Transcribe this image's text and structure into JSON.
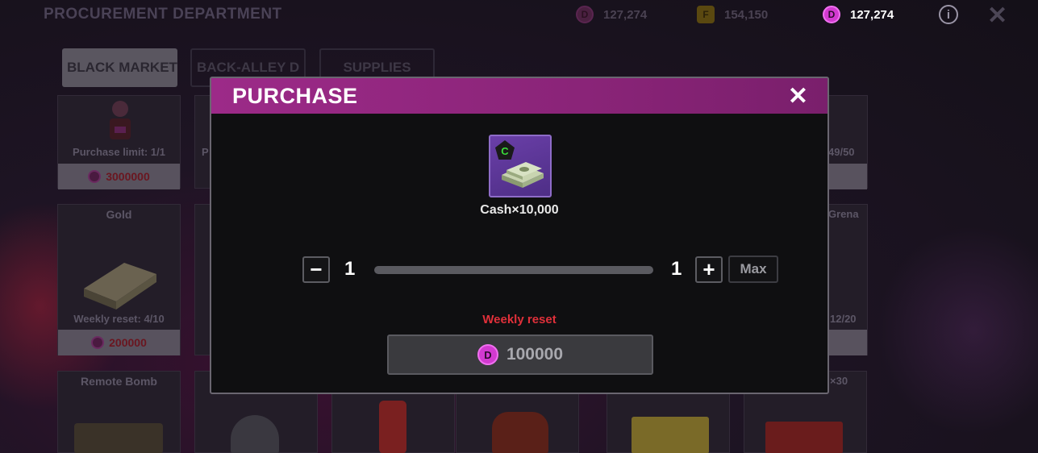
{
  "header": {
    "title": "PROCUREMENT DEPARTMENT",
    "currencies": [
      {
        "icon": "d-coin-icon",
        "letter": "D",
        "value": "127,274"
      },
      {
        "icon": "f-coin-icon",
        "letter": "F",
        "value": "154,150"
      },
      {
        "icon": "d-coin-icon",
        "letter": "D",
        "value": "127,274"
      }
    ],
    "info_symbol": "i",
    "close_symbol": "✕"
  },
  "tabs": [
    "BLACK MARKET",
    "BACK-ALLEY D",
    "SUPPLIES"
  ],
  "cards": [
    {
      "name": "",
      "note": "Purchase limit: 1/1",
      "price": "3000000"
    },
    {
      "name": "Gold",
      "note": "Weekly reset: 4/10",
      "price": "200000"
    },
    {
      "name": "Remote Bomb",
      "note": "",
      "price": ""
    }
  ],
  "side_fragments": {
    "col2_row1": "P",
    "col6_row1": "49/50",
    "col6_row2_name": "Grena",
    "col6_row2_note": "12/20",
    "col6_row3_name": "×30"
  },
  "modal": {
    "title": "PURCHASE",
    "close_symbol": "✕",
    "item": {
      "label": "Cash×10,000",
      "rarity_letter": "C",
      "icon": "cash-stack-icon"
    },
    "quantity": {
      "minus": "−",
      "plus": "+",
      "current": "1",
      "max_value": "1",
      "max_label": "Max",
      "slider_fraction": 0.0
    },
    "reset_note": "Weekly reset",
    "buy": {
      "coin_letter": "D",
      "price": "100000"
    }
  },
  "colors": {
    "accent_magenta": "#9c2a88",
    "warning_red": "#e0303a",
    "d_coin": "#d23ad0",
    "rarity_green": "#3adc3a"
  }
}
